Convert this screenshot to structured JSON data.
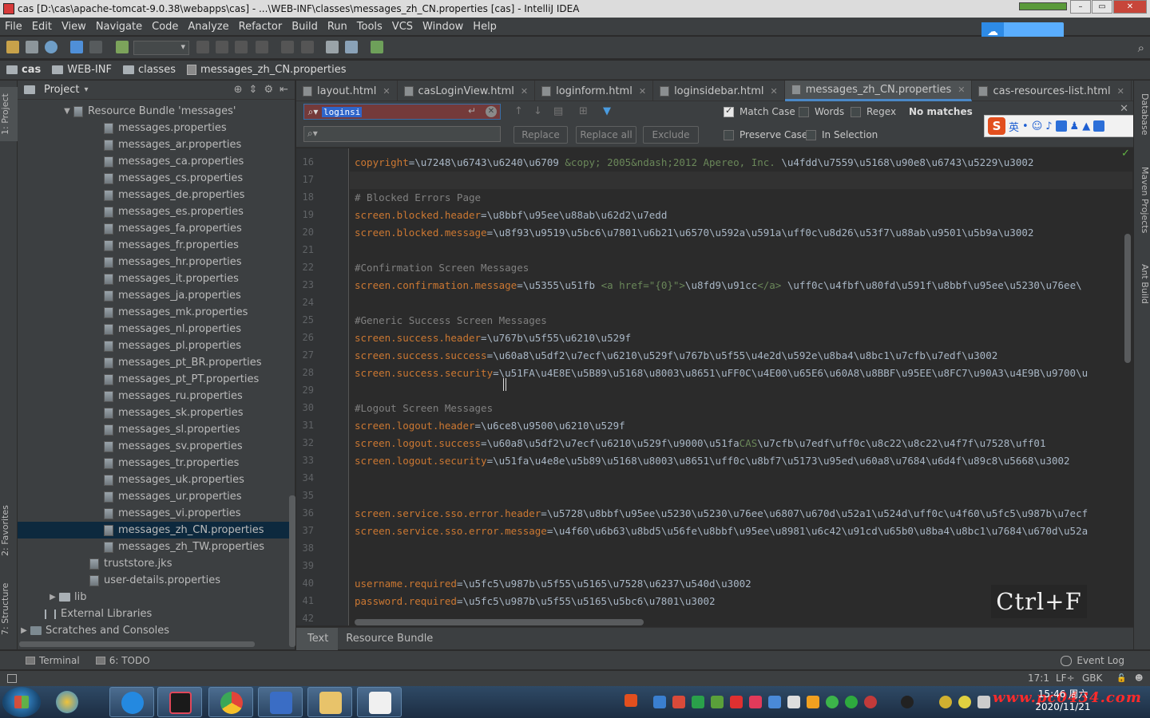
{
  "window": {
    "title": "cas [D:\\cas\\apache-tomcat-9.0.38\\webapps\\cas] - ...\\WEB-INF\\classes\\messages_zh_CN.properties [cas] - IntelliJ IDEA"
  },
  "menu": [
    "File",
    "Edit",
    "View",
    "Navigate",
    "Code",
    "Analyze",
    "Refactor",
    "Build",
    "Run",
    "Tools",
    "VCS",
    "Window",
    "Help"
  ],
  "breadcrumb": [
    "cas",
    "WEB-INF",
    "classes",
    "messages_zh_CN.properties"
  ],
  "left_strip": {
    "project": "1: Project",
    "favorites": "2: Favorites",
    "structure": "7: Structure"
  },
  "project_panel": {
    "title": "Project",
    "bundle": "Resource Bundle 'messages'",
    "files": [
      "messages.properties",
      "messages_ar.properties",
      "messages_ca.properties",
      "messages_cs.properties",
      "messages_de.properties",
      "messages_es.properties",
      "messages_fa.properties",
      "messages_fr.properties",
      "messages_hr.properties",
      "messages_it.properties",
      "messages_ja.properties",
      "messages_mk.properties",
      "messages_nl.properties",
      "messages_pl.properties",
      "messages_pt_BR.properties",
      "messages_pt_PT.properties",
      "messages_ru.properties",
      "messages_sk.properties",
      "messages_sl.properties",
      "messages_sv.properties",
      "messages_tr.properties",
      "messages_uk.properties",
      "messages_ur.properties",
      "messages_vi.properties",
      "messages_zh_CN.properties",
      "messages_zh_TW.properties"
    ],
    "selected_file": "messages_zh_CN.properties",
    "extra": [
      "truststore.jks",
      "user-details.properties"
    ],
    "lib": "lib",
    "external": "External Libraries",
    "scratches": "Scratches and Consoles"
  },
  "tabs": [
    "layout.html",
    "casLoginView.html",
    "loginform.html",
    "loginsidebar.html",
    "messages_zh_CN.properties",
    "cas-resources-list.html"
  ],
  "active_tab": "messages_zh_CN.properties",
  "find": {
    "query": "loginsi",
    "replace_btn": "Replace",
    "replace_all_btn": "Replace all",
    "exclude_btn": "Exclude",
    "match_case": "Match Case",
    "words": "Words",
    "regex": "Regex",
    "no_matches": "No matches",
    "preserve_case": "Preserve Case",
    "in_selection": "In Selection"
  },
  "ime": {
    "lang": "英"
  },
  "code_lines": [
    {
      "n": "16",
      "key": "copyright",
      "val": "=\\u7248\\u6743\\u6240\\u6709 ",
      "html": "&copy; 2005&ndash;2012 Apereo, Inc.",
      "tail": " \\u4fdd\\u7559\\u5168\\u90e8\\u6743\\u5229\\u3002"
    },
    {
      "n": "17"
    },
    {
      "n": "18",
      "comment": "# Blocked Errors Page"
    },
    {
      "n": "19",
      "key": "screen.blocked.header",
      "val": "=\\u8bbf\\u95ee\\u88ab\\u62d2\\u7edd"
    },
    {
      "n": "20",
      "key": "screen.blocked.message",
      "val": "=\\u8f93\\u9519\\u5bc6\\u7801\\u6b21\\u6570\\u592a\\u591a\\uff0c\\u8d26\\u53f7\\u88ab\\u9501\\u5b9a\\u3002"
    },
    {
      "n": "21"
    },
    {
      "n": "22",
      "comment": "#Confirmation Screen Messages"
    },
    {
      "n": "23",
      "key": "screen.confirmation.message",
      "val": "=\\u5355\\u51fb ",
      "html": "<a href=\"{0}\">",
      "tail": "\\u8fd9\\u91cc",
      "html2": "</a>",
      "tail2": " \\uff0c\\u4fbf\\u80fd\\u591f\\u8bbf\\u95ee\\u5230\\u76ee\\"
    },
    {
      "n": "24"
    },
    {
      "n": "25",
      "comment": "#Generic Success Screen Messages"
    },
    {
      "n": "26",
      "key": "screen.success.header",
      "val": "=\\u767b\\u5f55\\u6210\\u529f"
    },
    {
      "n": "27",
      "key": "screen.success.success",
      "val": "=\\u60a8\\u5df2\\u7ecf\\u6210\\u529f\\u767b\\u5f55\\u4e2d\\u592e\\u8ba4\\u8bc1\\u7cfb\\u7edf\\u3002"
    },
    {
      "n": "28",
      "key": "screen.success.security",
      "val": "=\\u51FA\\u4E8E\\u5B89\\u5168\\u8003\\u8651\\uFF0C\\u4E00\\u65E6\\u60A8\\u8BBF\\u95EE\\u8FC7\\u90A3\\u4E9B\\u9700\\u"
    },
    {
      "n": "29"
    },
    {
      "n": "30",
      "comment": "#Logout Screen Messages"
    },
    {
      "n": "31",
      "key": "screen.logout.header",
      "val": "=\\u6ce8\\u9500\\u6210\\u529f"
    },
    {
      "n": "32",
      "key": "screen.logout.success",
      "val": "=\\u60a8\\u5df2\\u7ecf\\u6210\\u529f\\u9000\\u51fa",
      "html": "CAS",
      "tail": "\\u7cfb\\u7edf\\uff0c\\u8c22\\u8c22\\u4f7f\\u7528\\uff01"
    },
    {
      "n": "33",
      "key": "screen.logout.security",
      "val": "=\\u51fa\\u4e8e\\u5b89\\u5168\\u8003\\u8651\\uff0c\\u8bf7\\u5173\\u95ed\\u60a8\\u7684\\u6d4f\\u89c8\\u5668\\u3002"
    },
    {
      "n": "34"
    },
    {
      "n": "35"
    },
    {
      "n": "36",
      "key": "screen.service.sso.error.header",
      "val": "=\\u5728\\u8bbf\\u95ee\\u5230\\u5230\\u76ee\\u6807\\u670d\\u52a1\\u524d\\uff0c\\u4f60\\u5fc5\\u987b\\u7ecf"
    },
    {
      "n": "37",
      "key": "screen.service.sso.error.message",
      "val": "=\\u4f60\\u6b63\\u8bd5\\u56fe\\u8bbf\\u95ee\\u8981\\u6c42\\u91cd\\u65b0\\u8ba4\\u8bc1\\u7684\\u670d\\u52a"
    },
    {
      "n": "38"
    },
    {
      "n": "39"
    },
    {
      "n": "40",
      "key": "username.required",
      "val": "=\\u5fc5\\u987b\\u5f55\\u5165\\u7528\\u6237\\u540d\\u3002"
    },
    {
      "n": "41",
      "key": "password.required",
      "val": "=\\u5fc5\\u987b\\u5f55\\u5165\\u5bc6\\u7801\\u3002"
    },
    {
      "n": "42"
    }
  ],
  "overlay_shortcut": "Ctrl+F",
  "right_strip": {
    "database": "Database",
    "maven": "Maven Projects",
    "ant": "Ant Build"
  },
  "bottom_editor_tabs": [
    "Text",
    "Resource Bundle"
  ],
  "tool_windows": {
    "terminal": "Terminal",
    "todo": "6: TODO",
    "event_log": "Event Log"
  },
  "status": {
    "position": "17:1",
    "line_sep": "LF÷",
    "encoding": "GBK"
  },
  "taskbar": {
    "time": "15:46 周六",
    "date": "2020/11/21"
  },
  "watermark": "www.pc0434.com"
}
